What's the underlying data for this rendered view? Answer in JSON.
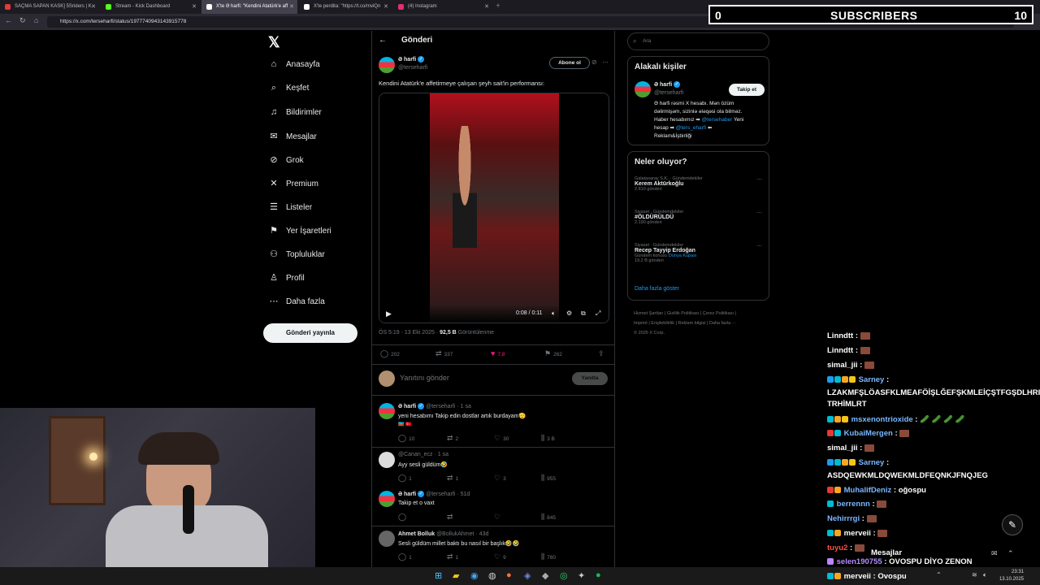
{
  "browser": {
    "tabs": [
      {
        "label": "SAÇMA SAPAN KASK] 5Sriders | K",
        "active": false,
        "color": "#e53935"
      },
      {
        "label": "Stream - Kick Dashboard",
        "active": false,
        "color": "#53fc18"
      },
      {
        "label": "X'te Ə harfi: \"Kendini Atatürk'e aff",
        "active": true,
        "color": "#ffffff"
      },
      {
        "label": "X'te perdita: \"https://t.co/mviQn",
        "active": false,
        "color": "#ffffff"
      },
      {
        "label": "(4) Instagram",
        "active": false,
        "color": "#e1306c"
      }
    ],
    "url": "https://x.com/terseharfi/status/1977740943143915778"
  },
  "overlay": {
    "subs_left": "0",
    "label": "SUBSCRIBERS",
    "subs_right": "10"
  },
  "nav": {
    "items": [
      {
        "label": "Anasayfa",
        "icon": "⌂"
      },
      {
        "label": "Keşfet",
        "icon": "⌕"
      },
      {
        "label": "Bildirimler",
        "icon": "♫"
      },
      {
        "label": "Mesajlar",
        "icon": "✉"
      },
      {
        "label": "Grok",
        "icon": "⊘"
      },
      {
        "label": "Premium",
        "icon": "✕"
      },
      {
        "label": "Listeler",
        "icon": "☰"
      },
      {
        "label": "Yer İşaretleri",
        "icon": "⚑"
      },
      {
        "label": "Topluluklar",
        "icon": "⚇"
      },
      {
        "label": "Profil",
        "icon": "♙"
      },
      {
        "label": "Daha fazla",
        "icon": "⋯"
      }
    ],
    "post_button": "Gönderi yayınla"
  },
  "main": {
    "header": "Gönderi",
    "post": {
      "name": "Ə harfi",
      "handle": "@terseharfi",
      "follow_label": "Abone ol",
      "text": "Kendini Atatürk'e affetirmeye çalışan şeyh sait'in performansı:",
      "video_time": "0:08 / 0:11",
      "timestamp": "ÖS 5:19 · 13 Eki 2025 · ",
      "views": "92,5 B",
      "views_label": " Görüntülenme",
      "replies": "202",
      "reposts": "337",
      "likes": "7,8",
      "bookmarks": "262"
    },
    "reply_placeholder": "Yanıtını gönder",
    "reply_button": "Yanıtla",
    "replies": [
      {
        "name": "Ə harfi",
        "handle": "@terseharfi · 1 sa",
        "text": "yeni hesabımı Takip edin dostlar artık burdayam🫡",
        "r": "10",
        "rt": "2",
        "l": "30",
        "v": "3 B"
      },
      {
        "name": "",
        "handle": "@Canan_ecz · 1 sa",
        "text": "Ayy sesli güldüm🤣",
        "r": "1",
        "rt": "1",
        "l": "3",
        "v": "955"
      },
      {
        "name": "Ə harfi",
        "handle": "@terseharfi · 51d",
        "text": "Takip et o vaxt",
        "r": "",
        "rt": "",
        "l": "",
        "v": "845"
      },
      {
        "name": "Ahmet Bolluk",
        "handle": "@BollukAhmet · 43d",
        "text": "Sesli güldüm millet baktı bu nasıl bir başlık🤣🤣",
        "r": "1",
        "rt": "1",
        "l": "9",
        "v": "760"
      }
    ]
  },
  "right": {
    "search_placeholder": "Ara",
    "related_title": "Alakalı kişiler",
    "related": {
      "name": "Ə harfi",
      "handle": "@terseharfi",
      "follow": "Takip et",
      "bio1": "Ə harfi rəsmi X hesabı. Mən özüm",
      "bio2": "dəlirmişəm, sizinlə ələqəsi ola bilməz.",
      "bio3": "Haber hesabımız ➡ ",
      "bio3_link": "@tersehaber",
      "bio3_end": " Yeni",
      "bio4": "hesap ➡ ",
      "bio4_link": "@ters_eharfi",
      "bio4_end": " ⬅",
      "bio5": "Reklam&İşbirliği"
    },
    "trends_title": "Neler oluyor?",
    "trends": [
      {
        "meta": "Galatasaray S.K. · Gündemdekiler",
        "name": "Kerem Aktürkoğlu",
        "count": "2.810 gönderi",
        "extra": ""
      },
      {
        "meta": "Siyaset · Gündemdekiler",
        "name": "#ÖLDÜRÜLDÜ",
        "count": "2.190 gönderi",
        "extra": ""
      },
      {
        "meta": "Siyaset · Gündemdekiler",
        "name": "Recep Tayyip Erdoğan",
        "count": "19,2 B gönderi",
        "extra": "Gündem konusu "
      }
    ],
    "trend3_link": "Dünya Kupası",
    "show_more": "Daha fazla göster",
    "footer1": "Hizmet Şartları  |  Gizlilik Politikası  |  Çerez Politikası  |",
    "footer2": "Imprint  |  Erişilebilirlik  |  Reklam bilgisi  |  Daha fazla ···",
    "footer3": "© 2025 X Corp."
  },
  "chat": {
    "messages": [
      {
        "user": "Linndtt",
        "color": "#ffffff",
        "text": ""
      },
      {
        "user": "Linndtt",
        "color": "#ffffff",
        "text": ""
      },
      {
        "user": "simal_jii",
        "color": "#ffffff",
        "text": ""
      },
      {
        "user": "Sarney",
        "color": "#7ab7ff",
        "text": ""
      },
      {
        "user": "",
        "color": "#ffffff",
        "text": "LZAKMFŞLÖASFKLMEAFÖİŞLĞEFŞKMLEİÇŞTFGŞDLHRI"
      },
      {
        "user": "",
        "color": "#ffffff",
        "text": "TRHİMLRT"
      },
      {
        "user": "msxenontrioxide",
        "color": "#7ab7ff",
        "text": ""
      },
      {
        "user": "KubaiMergen",
        "color": "#7ab7ff",
        "text": ""
      },
      {
        "user": "simal_jii",
        "color": "#ffffff",
        "text": ""
      },
      {
        "user": "Sarney",
        "color": "#7ab7ff",
        "text": ""
      },
      {
        "user": "",
        "color": "#ffffff",
        "text": "ASDQEWKMLDQWEKMLDFEQNKJFNQJEG"
      },
      {
        "user": "MuhalifDeniz",
        "color": "#7ab7ff",
        "text": "oğospu"
      },
      {
        "user": "berrennn",
        "color": "#7ab7ff",
        "text": ""
      },
      {
        "user": "Nehirrrgi",
        "color": "#7ab7ff",
        "text": ""
      },
      {
        "user": "merveii",
        "color": "#ffffff",
        "text": ""
      },
      {
        "user": "tuyu2",
        "color": "#ff4d4d",
        "text": ""
      },
      {
        "user": "selen190755",
        "color": "#b48cff",
        "text": "OVOSPU DİYO ZENON"
      },
      {
        "user": "merveii",
        "color": "#ffffff",
        "text": "Ovospu"
      }
    ],
    "messages_label": "Mesajlar"
  },
  "taskbar": {
    "time": "23:31",
    "date": "13.10.2025"
  }
}
